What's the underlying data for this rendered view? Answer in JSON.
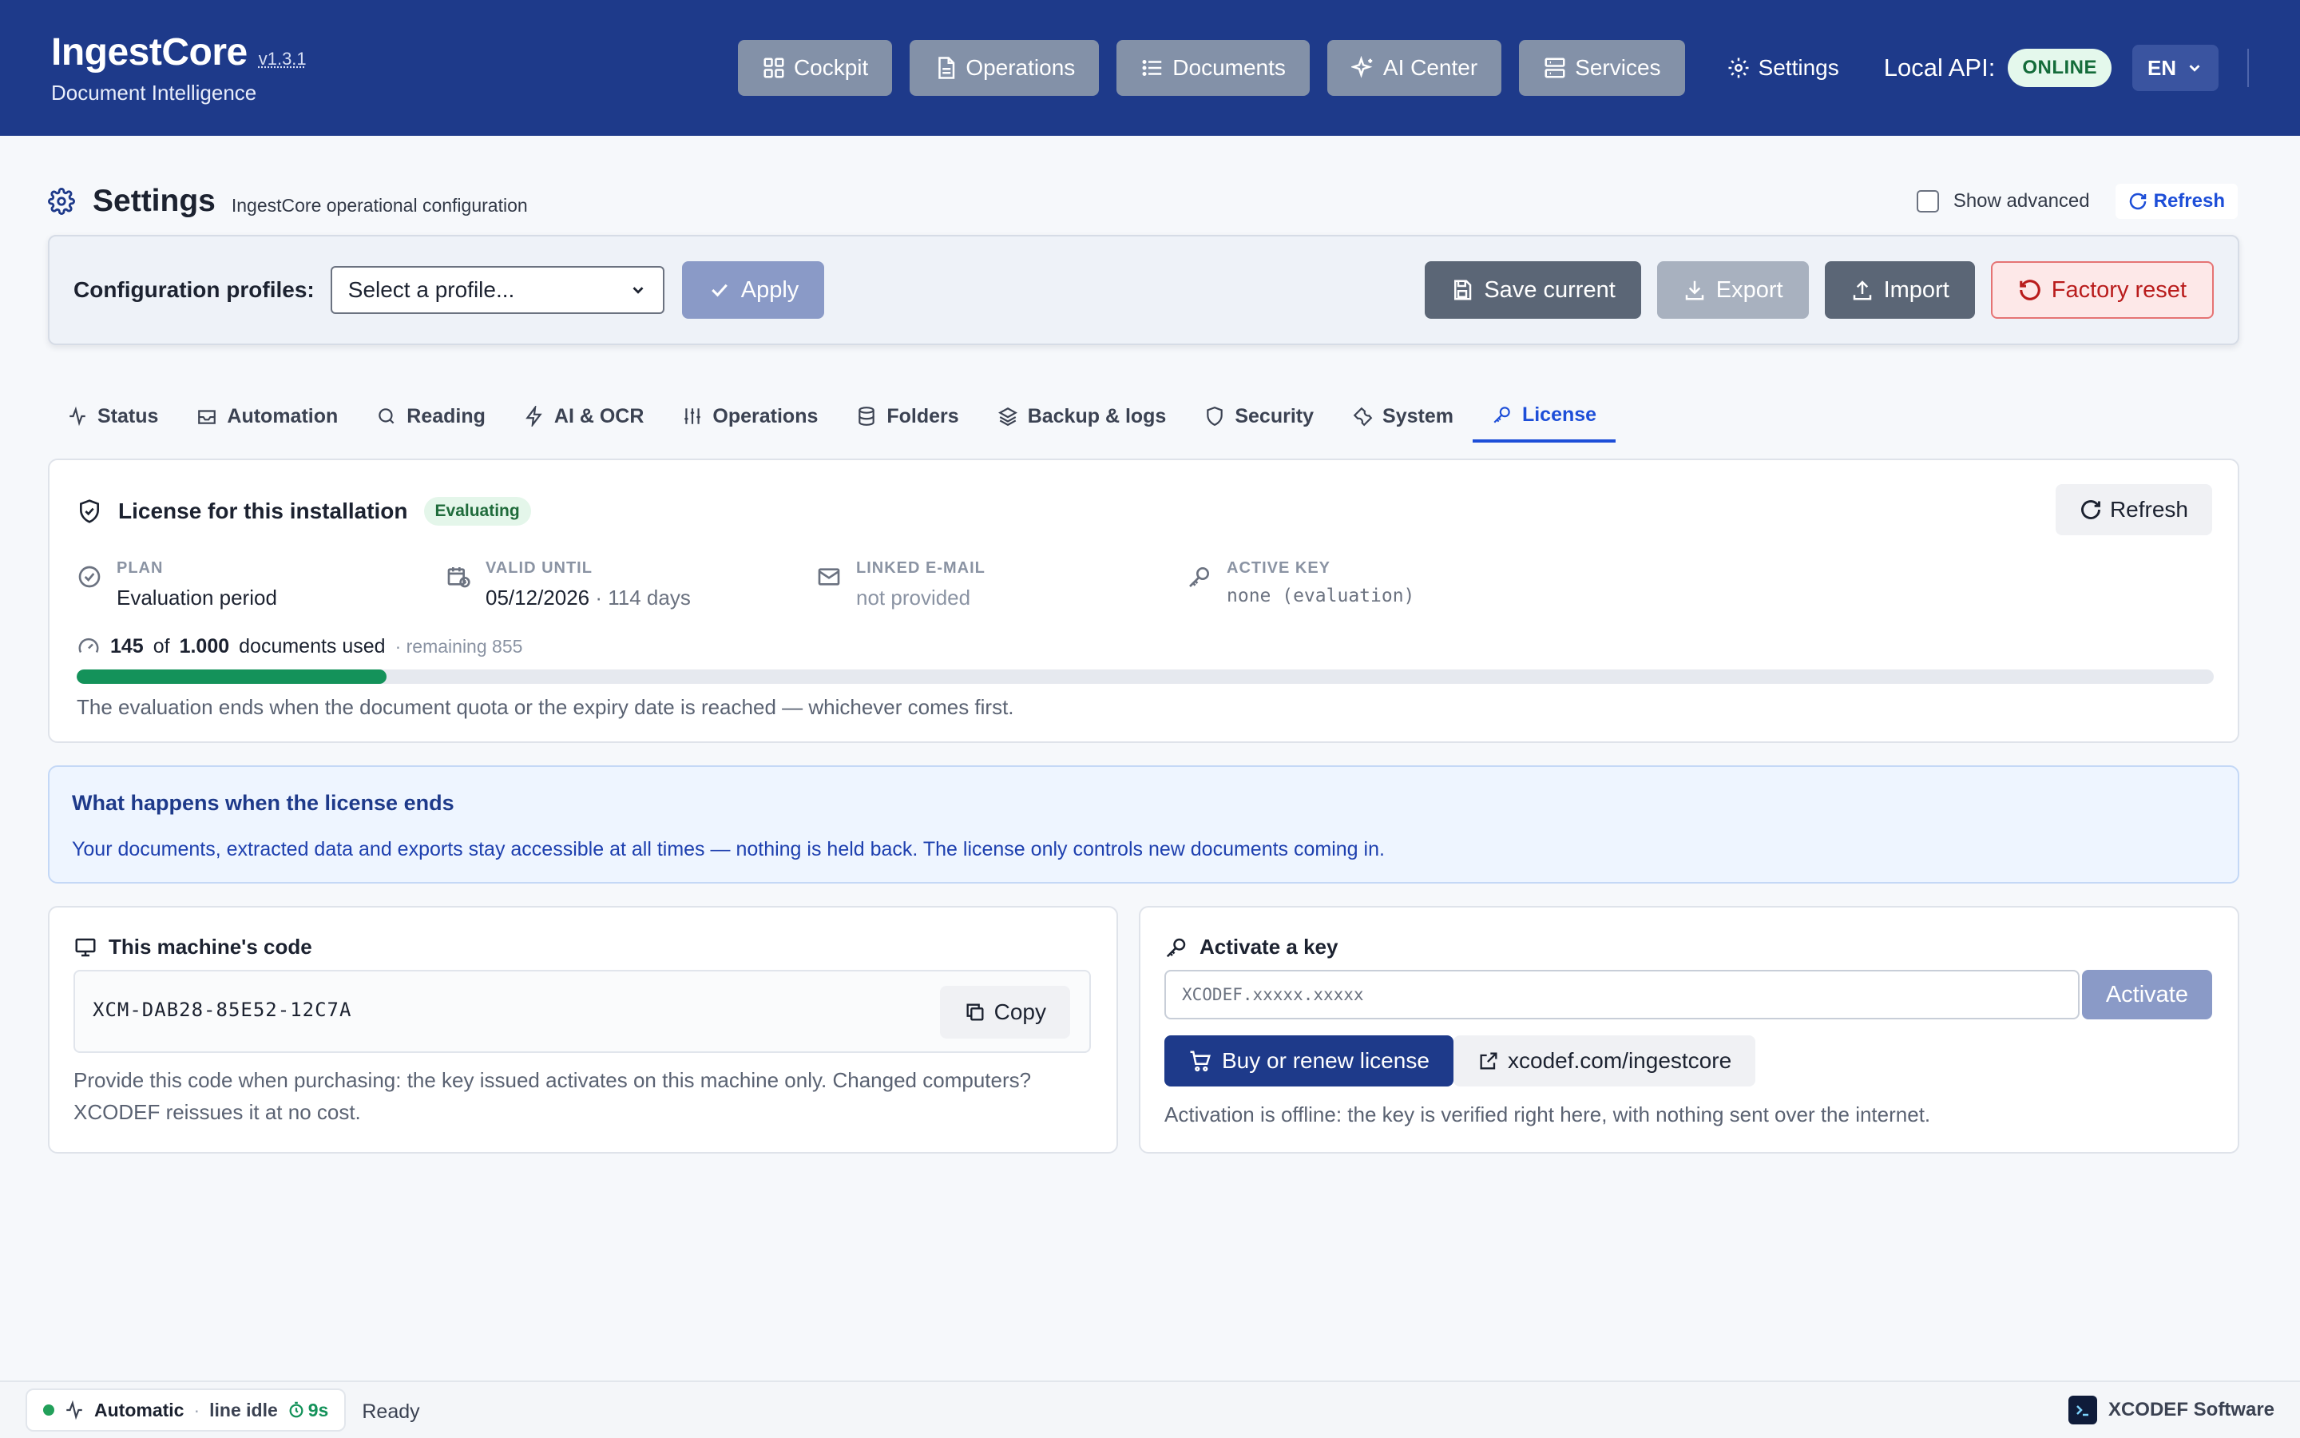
{
  "app": {
    "name": "IngestCore",
    "version": "v1.3.1",
    "subtitle": "Document Intelligence"
  },
  "nav": {
    "buttons": [
      {
        "label": "Cockpit",
        "icon": "grid-icon"
      },
      {
        "label": "Operations",
        "icon": "document-icon"
      },
      {
        "label": "Documents",
        "icon": "list-icon"
      },
      {
        "label": "AI Center",
        "icon": "sparkles-icon"
      },
      {
        "label": "Services",
        "icon": "server-icon"
      }
    ],
    "settings_label": "Settings",
    "api_label": "Local API:",
    "api_status": "ONLINE",
    "language": "EN"
  },
  "page": {
    "title": "Settings",
    "subtitle": "IngestCore operational configuration",
    "show_advanced": "Show advanced",
    "refresh": "Refresh"
  },
  "profiles": {
    "label": "Configuration profiles:",
    "select_placeholder": "Select a profile...",
    "apply": "Apply",
    "save_current": "Save current",
    "export": "Export",
    "import": "Import",
    "factory_reset": "Factory reset"
  },
  "tabs": [
    {
      "label": "Status",
      "icon": "pulse-icon"
    },
    {
      "label": "Automation",
      "icon": "inbox-icon"
    },
    {
      "label": "Reading",
      "icon": "search-icon"
    },
    {
      "label": "AI & OCR",
      "icon": "bolt-icon"
    },
    {
      "label": "Operations",
      "icon": "sliders-icon"
    },
    {
      "label": "Folders",
      "icon": "database-icon"
    },
    {
      "label": "Backup & logs",
      "icon": "layers-icon"
    },
    {
      "label": "Security",
      "icon": "shield-icon"
    },
    {
      "label": "System",
      "icon": "wrench-icon"
    },
    {
      "label": "License",
      "icon": "key-icon",
      "active": true
    }
  ],
  "license": {
    "title": "License for this installation",
    "badge": "Evaluating",
    "refresh": "Refresh",
    "plan_label": "PLAN",
    "plan_value": "Evaluation period",
    "valid_label": "VALID UNTIL",
    "valid_date": "05/12/2026",
    "valid_days": "· 114 days",
    "email_label": "LINKED E-MAIL",
    "email_value": "not provided",
    "key_label": "ACTIVE KEY",
    "key_value": "none (evaluation)",
    "used": "145",
    "of": "of",
    "quota": "1.000",
    "used_suffix": "documents used",
    "remaining": "· remaining 855",
    "progress_fraction": 0.145,
    "note": "The evaluation ends when the document quota or the expiry date is reached — whichever comes first."
  },
  "info": {
    "title": "What happens when the license ends",
    "text": "Your documents, extracted data and exports stay accessible at all times — nothing is held back. The license only controls new documents coming in."
  },
  "machine": {
    "title": "This machine's code",
    "code": "XCM-DAB28-85E52-12C7A",
    "copy": "Copy",
    "note": "Provide this code when purchasing: the key issued activates on this machine only. Changed computers? XCODEF reissues it at no cost."
  },
  "activate": {
    "title": "Activate a key",
    "placeholder": "XCODEF.xxxxx.xxxxx",
    "button": "Activate",
    "buy": "Buy or renew license",
    "site": "xcodef.com/ingestcore",
    "note": "Activation is offline: the key is verified right here, with nothing sent over the internet."
  },
  "status_bar": {
    "mode": "Automatic",
    "separator": "·",
    "line_state": "line idle",
    "timer": "9s",
    "ready": "Ready",
    "vendor": "XCODEF Software"
  },
  "colors": {
    "header": "#1e3a8a",
    "accent": "#1d4ed8",
    "success": "#14925a",
    "danger": "#b91c1c"
  }
}
